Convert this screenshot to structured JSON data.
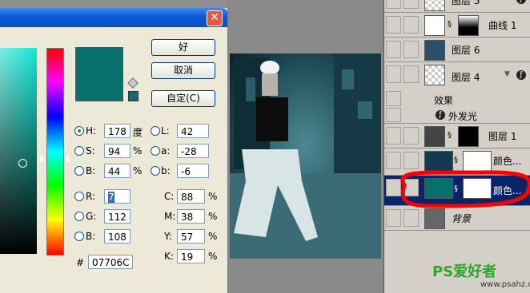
{
  "dialog": {
    "ok_label": "好",
    "cancel_label": "取消",
    "custom_label": "自定(C)",
    "current_color": "#07706C"
  },
  "hsb": {
    "h_label": "H:",
    "h_value": "178",
    "h_unit": "度",
    "s_label": "S:",
    "s_value": "94",
    "s_unit": "%",
    "b_label": "B:",
    "b_value": "44",
    "b_unit": "%"
  },
  "lab": {
    "l_label": "L:",
    "l_value": "42",
    "a_label": "a:",
    "a_value": "-28",
    "b_label": "b:",
    "b_value": "-6"
  },
  "rgb": {
    "r_label": "R:",
    "r_value": "7",
    "g_label": "G:",
    "g_value": "112",
    "b_label": "B:",
    "b_value": "108"
  },
  "cmyk": {
    "c_label": "C:",
    "c_value": "88",
    "m_label": "M:",
    "m_value": "38",
    "y_label": "Y:",
    "y_value": "57",
    "k_label": "K:",
    "k_value": "19",
    "unit": "%"
  },
  "hex": {
    "label": "#",
    "value": "07706C"
  },
  "layers": {
    "rows": [
      {
        "name": "图层 5"
      },
      {
        "name": "曲线 1"
      },
      {
        "name": "图层 6"
      },
      {
        "name": "图层 4"
      },
      {
        "name": "效果"
      },
      {
        "name": "外发光"
      },
      {
        "name": "图层 1"
      },
      {
        "name": "颜色..."
      },
      {
        "name": "颜色..."
      },
      {
        "name": "背景"
      }
    ]
  },
  "watermark": {
    "brand": "PS爱好者",
    "url": "www.psahz.com"
  },
  "colors": {
    "highlight_circle": "#ff0000",
    "selection": "#0a246a",
    "titlebar": "#0a5bd9"
  }
}
